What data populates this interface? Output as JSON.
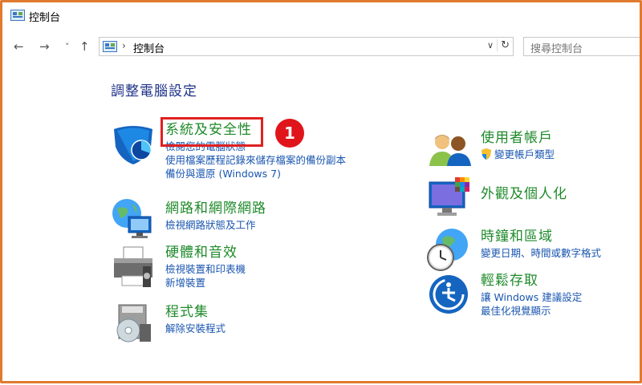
{
  "window": {
    "title": "控制台"
  },
  "nav": {
    "back": "←",
    "forward": "→",
    "recent": "˅",
    "up": "↑",
    "address_sep": "›",
    "address_text": "控制台",
    "address_drop": "∨",
    "refresh": "↻",
    "search_placeholder": "搜尋控制台"
  },
  "heading": "調整電腦設定",
  "annotation": {
    "badge": "1",
    "color": "#e02020"
  },
  "left": [
    {
      "title": "系統及安全性",
      "links": [
        "檢閱您的電腦狀態",
        "使用檔案歷程記錄來儲存檔案的備份副本",
        "備份與還原 (Windows 7)"
      ],
      "icon": "security-shield-icon"
    },
    {
      "title": "網路和網際網路",
      "links": [
        "檢視網路狀態及工作"
      ],
      "icon": "network-globe-icon"
    },
    {
      "title": "硬體和音效",
      "links": [
        "檢視裝置和印表機",
        "新增裝置"
      ],
      "icon": "printer-icon"
    },
    {
      "title": "程式集",
      "links": [
        "解除安裝程式"
      ],
      "icon": "programs-disc-icon"
    }
  ],
  "right": [
    {
      "title": "使用者帳戶",
      "links": [
        "變更帳戶類型"
      ],
      "icon": "users-icon"
    },
    {
      "title": "外觀及個人化",
      "links": [],
      "icon": "monitor-palette-icon"
    },
    {
      "title": "時鐘和區域",
      "links": [
        "變更日期、時間或數字格式"
      ],
      "icon": "clock-globe-icon"
    },
    {
      "title": "輕鬆存取",
      "links": [
        "讓 Windows 建議設定",
        "最佳化視覺顯示"
      ],
      "icon": "accessibility-icon"
    }
  ],
  "colors": {
    "frame": "#e07a2e",
    "heading": "#1e3287",
    "category": "#1e8a2a",
    "link": "#1a56b0"
  }
}
